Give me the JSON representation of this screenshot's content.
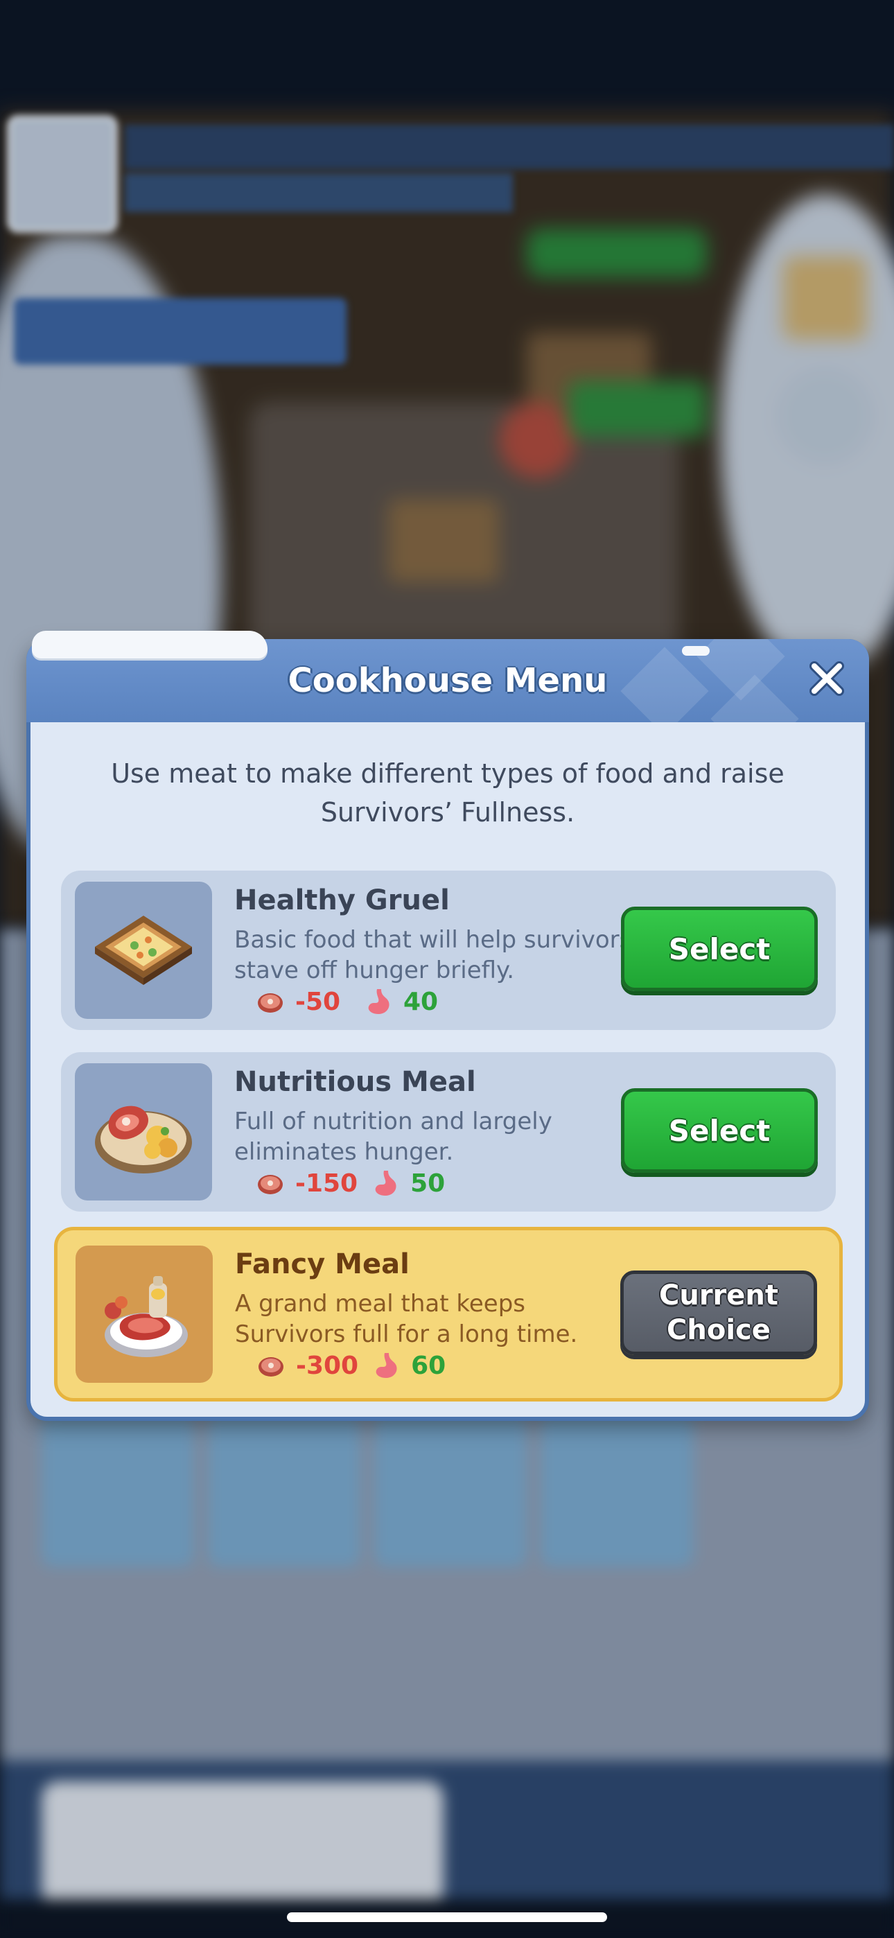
{
  "dialog": {
    "title": "Cookhouse Menu",
    "description": "Use meat to make different types of food and raise Survivors’ Fullness."
  },
  "food_items": [
    {
      "name": "Healthy Gruel",
      "description": "Basic food that will help survivors stave off hunger briefly.",
      "meat_cost": "-50",
      "fullness": "40",
      "button_label": "Select",
      "selected": false
    },
    {
      "name": "Nutritious Meal",
      "description": "Full of nutrition and largely eliminates hunger.",
      "meat_cost": "-150",
      "fullness": "50",
      "button_label": "Select",
      "selected": false
    },
    {
      "name": "Fancy Meal",
      "description": "A grand meal that keeps Survivors full for a long time.",
      "meat_cost": "-300",
      "fullness": "60",
      "button_label": "Current\nChoice",
      "selected": true
    }
  ],
  "colors": {
    "header": "#5a83c0",
    "select_green": "#1fa534",
    "current_gray": "#575c66",
    "cost_red": "#e0453d",
    "gain_green": "#2da23a",
    "selected_bg": "#f5d77a"
  },
  "icons": {
    "close": "close-icon",
    "meat": "meat-icon",
    "stomach": "stomach-icon"
  }
}
